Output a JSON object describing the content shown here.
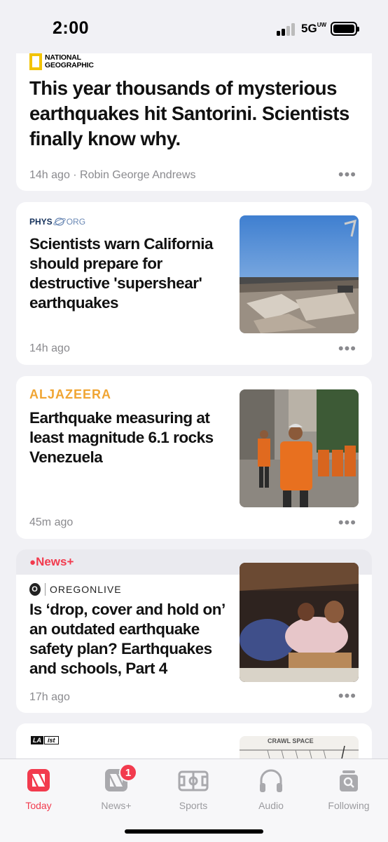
{
  "status_bar": {
    "time": "2:00",
    "network": "5G",
    "network_suffix": "UW"
  },
  "feed": [
    {
      "publisher": "NATIONAL GEOGRAPHIC",
      "publisher_line1": "NATIONAL",
      "publisher_line2": "GEOGRAPHIC",
      "headline": "This year thousands of mysterious earthquakes hit Santorini. Scientists finally know why.",
      "meta": "14h ago · Robin George Andrews"
    },
    {
      "publisher": "PHYS.ORG",
      "publisher_part1": "PHYS",
      "publisher_part2": "ORG",
      "headline": "Scientists warn California should prepare for destructive 'supershear' earthquakes",
      "meta": "14h ago"
    },
    {
      "publisher": "ALJAZEERA",
      "headline": "Earthquake measuring at least magnitude 6.1 rocks Venezuela",
      "meta": "45m ago"
    },
    {
      "tag": "News+",
      "publisher": "OREGONLIVE",
      "publisher_icon": "O",
      "headline": "Is ‘drop, cover and hold on’ an outdated earthquake safety plan? Earthquakes and schools, Part 4",
      "meta": "17h ago"
    },
    {
      "publisher_part1": "LA",
      "publisher_part2": "ist",
      "image_label": "CRAWL SPACE"
    }
  ],
  "more_label": "•••",
  "tabs": [
    {
      "label": "Today",
      "icon": "news-icon",
      "active": true
    },
    {
      "label": "News+",
      "icon": "news-plus-icon",
      "badge": "1"
    },
    {
      "label": "Sports",
      "icon": "sports-field-icon"
    },
    {
      "label": "Audio",
      "icon": "headphones-icon"
    },
    {
      "label": "Following",
      "icon": "following-search-icon"
    }
  ],
  "colors": {
    "accent": "#f23b4e",
    "natgeo_yellow": "#f2c300",
    "aljazeera": "#f0a533",
    "background": "#f1f1f5"
  }
}
